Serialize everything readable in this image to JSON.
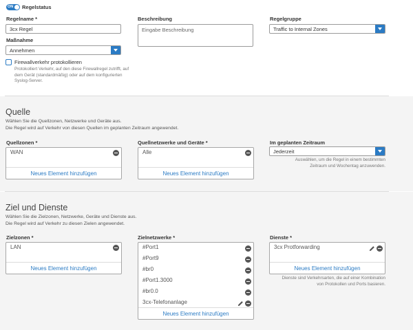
{
  "status": {
    "toggle_label": "ON",
    "label": "Regelstatus"
  },
  "rule_name": {
    "label": "Regelname",
    "required_mark": "*",
    "value": "3cx Regel"
  },
  "description": {
    "label": "Beschreibung",
    "placeholder": "Eingabe Beschreibung"
  },
  "rule_group": {
    "label": "Regelgruppe",
    "value": "Traffic to Internal Zones"
  },
  "action": {
    "label": "Maßnahme",
    "value": "Annehmen"
  },
  "log_traffic": {
    "label": "Firewallverkehr protokollieren",
    "help": [
      "Protokolliert Verkehr, auf den diese Firewallregel zutrifft, auf",
      "dem Gerät (standardmäßig) oder auf dem konfigurierten",
      "Syslog-Server."
    ]
  },
  "source": {
    "title": "Quelle",
    "subtitle": [
      "Wählen Sie die Quellzonen, Netzwerke und Geräte aus.",
      "Die Regel wird auf Verkehr von diesen Quellen im geplanten Zeitraum angewendet."
    ],
    "zones": {
      "label": "Quellzonen",
      "items": [
        "WAN"
      ],
      "add_label": "Neues Element hinzufügen"
    },
    "networks": {
      "label": "Quellnetzwerke und Geräte",
      "items": [
        "Alle"
      ],
      "add_label": "Neues Element hinzufügen"
    },
    "schedule": {
      "label": "Im geplanten Zeitraum",
      "value": "Jederzeit",
      "help": [
        "Auswählen, um die Regel in einem bestimmten",
        "Zeitraum und Wochentag anzuwenden."
      ]
    }
  },
  "destination": {
    "title": "Ziel und Dienste",
    "subtitle": [
      "Wählen Sie die Zielzonen, Netzwerke, Geräte und Dienste aus.",
      "Die Regel wird auf Verkehr zu diesen Zielen angewendet."
    ],
    "zones": {
      "label": "Zielzonen",
      "items": [
        "LAN"
      ],
      "add_label": "Neues Element hinzufügen"
    },
    "networks": {
      "label": "Zielnetzwerke",
      "items": [
        "#Port1",
        "#Port9",
        "#br0",
        "#Port1.3000",
        "#br0.0",
        "3cx-Telefonanlage"
      ],
      "add_label": "Neues Element hinzufügen"
    },
    "services": {
      "label": "Dienste",
      "items": [
        "3cx Protforwarding"
      ],
      "add_label": "Neues Element hinzufügen",
      "help": [
        "Dienste sind Verkehrsarten, die auf einer Kombination",
        "von Protokollen und Ports basieren."
      ]
    }
  },
  "colors": {
    "accent": "#2b7bc4",
    "panel": "#f4f4f4"
  },
  "icons": {
    "minus": "remove-circle-icon",
    "edit": "pencil-icon",
    "dropdown": "chevron-down-icon"
  }
}
